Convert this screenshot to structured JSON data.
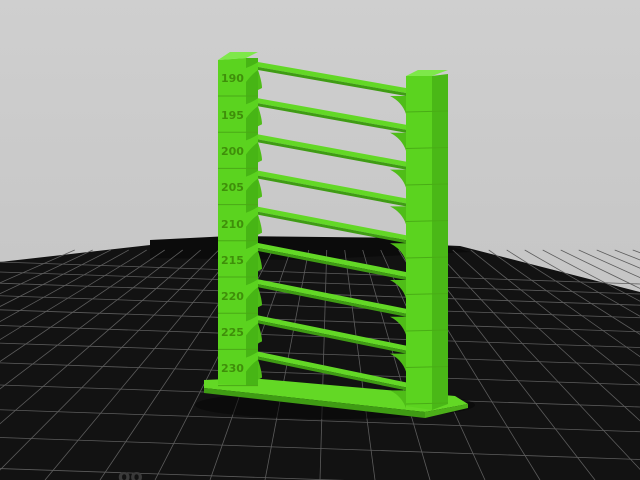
{
  "viewport": {
    "background": "#c9c9c9",
    "bed_color": "#111111",
    "grid_color": "#6a6a6a",
    "model_color": "#5bd31f",
    "model_shadow_color": "#3e9c12"
  },
  "model": {
    "name": "temperature-tower",
    "temperature_labels": [
      "190",
      "195",
      "200",
      "205",
      "210",
      "215",
      "220",
      "225",
      "230"
    ]
  }
}
